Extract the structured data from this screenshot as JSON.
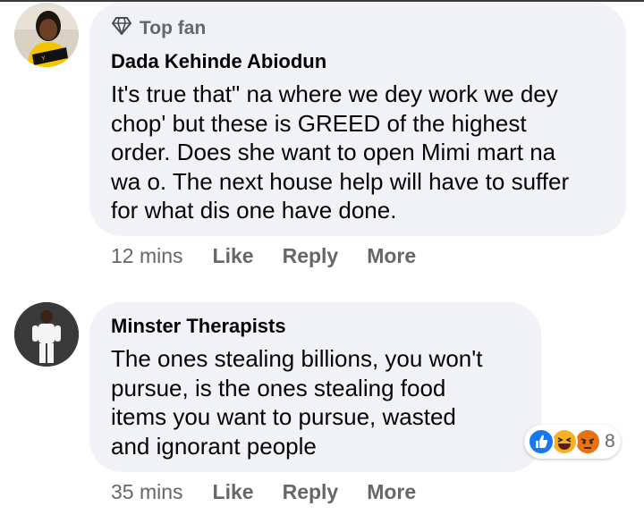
{
  "comments": [
    {
      "badge": "Top fan",
      "author": "Dada Kehinde Abiodun",
      "text_lines": [
        "It's true that\" na where we dey work we dey",
        "chop' but these is GREED of the highest",
        "order. Does she want to open Mimi mart na",
        "wa o. The next house help will have to suffer",
        "for what dis one have done."
      ],
      "time": "12 mins",
      "actions": [
        "Like",
        "Reply",
        "More"
      ]
    },
    {
      "author": "Minster Therapists",
      "text_lines": [
        "The ones stealing billions, you won't",
        "pursue, is the ones stealing food",
        "items you want to pursue, wasted",
        "and ignorant people"
      ],
      "time": "35 mins",
      "actions": [
        "Like",
        "Reply",
        "More"
      ],
      "reactions": {
        "icons": [
          "like-reaction",
          "haha-reaction",
          "angry-reaction"
        ],
        "count": "8"
      }
    }
  ],
  "colors": {
    "bubble": "#f0f2f5",
    "secondary_text": "#65676b",
    "like_blue": "#1877f2",
    "haha_yellow": "#f7b125",
    "angry_orange": "#e9710f"
  }
}
